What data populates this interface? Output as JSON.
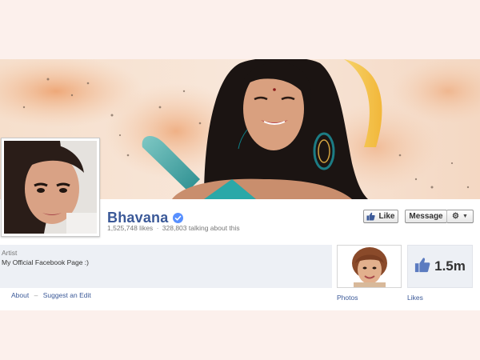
{
  "page": {
    "name": "Bhavana",
    "likes_count": "1,525,748 likes",
    "separator": "·",
    "talking_about": "328,803 talking about this",
    "category": "Artist",
    "description": "My Official Facebook Page :)"
  },
  "actions": {
    "like_label": "Like",
    "message_label": "Message"
  },
  "links": {
    "about": "About",
    "separator": "–",
    "suggest_edit": "Suggest an Edit"
  },
  "apps": {
    "photos_label": "Photos",
    "likes_label": "Likes",
    "likes_total": "1.5m"
  },
  "icons": {
    "verified": "verified-badge-icon",
    "like": "thumbs-up-icon",
    "gear": "gear-icon",
    "dropdown": "caret-down-icon"
  },
  "colors": {
    "brand_blue": "#3b5998",
    "verified_blue": "#5890ff",
    "panel_gray": "#edf0f5"
  }
}
